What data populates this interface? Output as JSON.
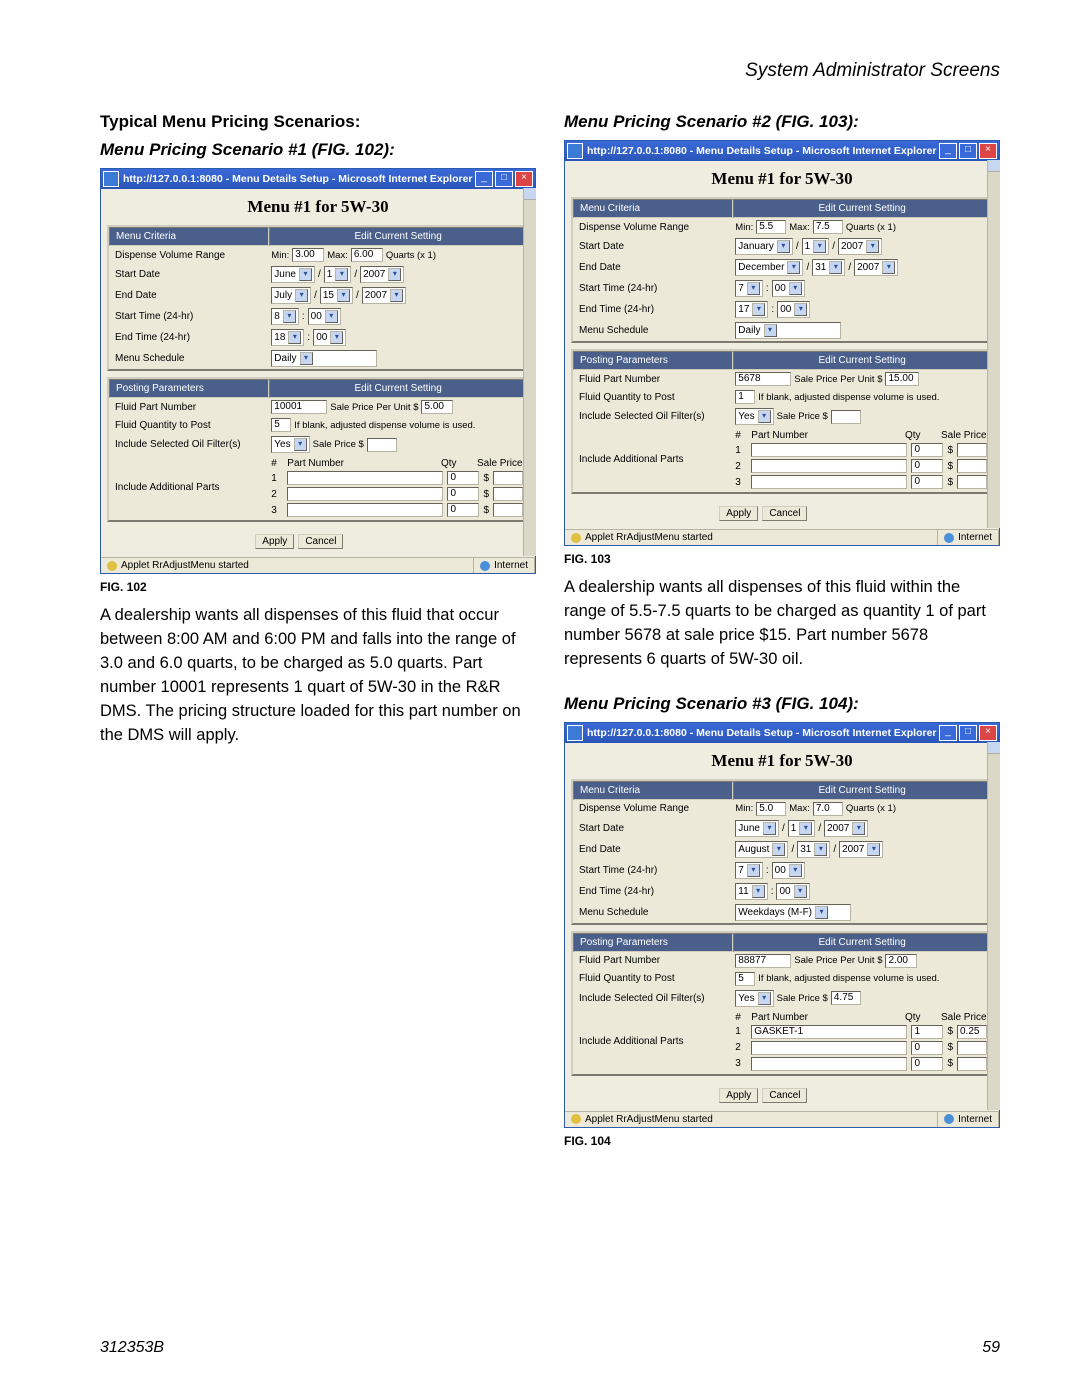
{
  "header": {
    "title": "System Administrator Screens"
  },
  "left": {
    "heading": "Typical Menu Pricing Scenarios:",
    "subheading": "Menu Pricing Scenario #1 (FIG. 102):",
    "fig_caption": "FIG. 102",
    "body": "A dealership wants all dispenses of this fluid that occur between 8:00 AM and 6:00 PM and falls into the range of 3.0 and 6.0 quarts, to be charged as 5.0 quarts. Part number 10001 represents 1 quart of 5W-30 in the R&R DMS. The pricing structure loaded for this part number on the DMS will apply.",
    "win": {
      "titlebar": "http://127.0.0.1:8080 - Menu Details Setup - Microsoft Internet Explorer",
      "menu_title": "Menu #1 for 5W-30",
      "col_menu_criteria": "Menu Criteria",
      "col_edit_current": "Edit Current Setting",
      "labels": {
        "dvr": "Dispense Volume Range",
        "start_date": "Start Date",
        "end_date": "End Date",
        "start_time": "Start Time (24-hr)",
        "end_time": "End Time (24-hr)",
        "menu_schedule": "Menu Schedule",
        "posting_params": "Posting Parameters",
        "fpn": "Fluid Part Number",
        "fqp": "Fluid Quantity to Post",
        "iso": "Include Selected Oil Filter(s)",
        "iap": "Include Additional Parts"
      },
      "vals": {
        "min_label": "Min:",
        "min": "3.00",
        "max_label": "Max:",
        "max": "6.00",
        "units": "Quarts (x 1)",
        "start_month": "June",
        "start_day": "1",
        "start_year": "2007",
        "end_month": "July",
        "end_day": "15",
        "end_year": "2007",
        "st_h": "8",
        "st_m": "00",
        "et_h": "18",
        "et_m": "00",
        "schedule": "Daily",
        "fpn": "10001",
        "sppu_label": "Sale Price Per Unit $",
        "sppu": "5.00",
        "fqp": "5",
        "fqp_hint": "If blank, adjusted dispense volume is used.",
        "iso": "Yes",
        "iso_price_label": "Sale Price $",
        "iso_price": "",
        "parts_hdr_num": "#",
        "parts_hdr_part": "Part Number",
        "parts_hdr_qty": "Qty",
        "parts_hdr_price": "Sale Price",
        "p1n": "1",
        "p1pn": "",
        "p1q": "0",
        "p1p": "",
        "p2n": "2",
        "p2pn": "",
        "p2q": "0",
        "p2p": "",
        "p3n": "3",
        "p3pn": "",
        "p3q": "0",
        "p3p": "",
        "apply": "Apply",
        "cancel": "Cancel",
        "status": "Applet RrAdjustMenu started",
        "net": "Internet"
      }
    }
  },
  "right": {
    "subheading2": "Menu Pricing Scenario #2 (FIG. 103):",
    "fig103": "FIG. 103",
    "body2": "A dealership wants all dispenses of this fluid within the range of 5.5-7.5 quarts to be charged as quantity 1 of part number 5678 at sale price $15. Part number 5678 represents 6 quarts of 5W-30 oil.",
    "subheading3": "Menu Pricing Scenario #3 (FIG. 104):",
    "fig104": "FIG. 104",
    "win2": {
      "titlebar": "http://127.0.0.1:8080 - Menu Details Setup - Microsoft Internet Explorer",
      "menu_title": "Menu #1 for 5W-30",
      "vals": {
        "min": "5.5",
        "max": "7.5",
        "units": "Quarts (x 1)",
        "start_month": "January",
        "start_day": "1",
        "start_year": "2007",
        "end_month": "December",
        "end_day": "31",
        "end_year": "2007",
        "st_h": "7",
        "st_m": "00",
        "et_h": "17",
        "et_m": "00",
        "schedule": "Daily",
        "fpn": "5678",
        "sppu": "15.00",
        "fqp": "1",
        "iso": "Yes",
        "iso_price": "",
        "p1n": "1",
        "p1pn": "",
        "p1q": "0",
        "p1p": "",
        "p2n": "2",
        "p2pn": "",
        "p2q": "0",
        "p2p": "",
        "p3n": "3",
        "p3pn": "",
        "p3q": "0",
        "p3p": "",
        "status": "Applet RrAdjustMenu started",
        "net": "Internet"
      }
    },
    "win3": {
      "titlebar": "http://127.0.0.1:8080 - Menu Details Setup - Microsoft Internet Explorer",
      "menu_title": "Menu #1 for 5W-30",
      "vals": {
        "min": "5.0",
        "max": "7.0",
        "units": "Quarts (x 1)",
        "start_month": "June",
        "start_day": "1",
        "start_year": "2007",
        "end_month": "August",
        "end_day": "31",
        "end_year": "2007",
        "st_h": "7",
        "st_m": "00",
        "et_h": "11",
        "et_m": "00",
        "schedule": "Weekdays (M-F)",
        "fpn": "88877",
        "sppu": "2.00",
        "fqp": "5",
        "iso": "Yes",
        "iso_price": "4.75",
        "p1n": "1",
        "p1pn": "GASKET-1",
        "p1q": "1",
        "p1p": "0.25",
        "p2n": "2",
        "p2pn": "",
        "p2q": "0",
        "p2p": "",
        "p3n": "3",
        "p3pn": "",
        "p3q": "0",
        "p3p": "",
        "status": "Applet RrAdjustMenu started",
        "net": "Internet"
      }
    }
  },
  "footer": {
    "doc": "312353B",
    "page": "59"
  },
  "common": {
    "slash": "/",
    "colon": ":",
    "dollar": "$",
    "min_label": "Min:",
    "max_label": "Max:",
    "sppu_label": "Sale Price Per Unit $",
    "iso_price_label": "Sale Price $",
    "fqp_hint": "If blank, adjusted dispense volume is used.",
    "parts_hdr_num": "#",
    "parts_hdr_part": "Part Number",
    "parts_hdr_qty": "Qty",
    "parts_hdr_price": "Sale Price",
    "apply": "Apply",
    "cancel": "Cancel"
  }
}
